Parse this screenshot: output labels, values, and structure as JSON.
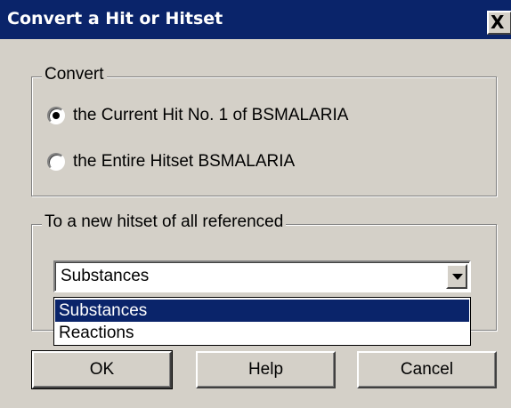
{
  "window": {
    "title": "Convert a Hit or Hitset",
    "close_icon": "close-icon",
    "close_glyph": "X"
  },
  "convert_group": {
    "label": "Convert",
    "options": [
      {
        "label": "the Current Hit No. 1 of BSMALARIA",
        "selected": true
      },
      {
        "label": "the Entire Hitset BSMALARIA",
        "selected": false
      }
    ]
  },
  "target_group": {
    "label": "To a new hitset of all referenced",
    "combo_value": "Substances",
    "dropdown_icon": "chevron-down-icon",
    "options": [
      {
        "label": "Substances",
        "highlighted": true
      },
      {
        "label": "Reactions",
        "highlighted": false
      }
    ]
  },
  "buttons": {
    "ok_label": "OK",
    "help_label": "Help",
    "cancel_label": "Cancel"
  },
  "colors": {
    "titlebar": "#0a246a",
    "face": "#d4d0c8",
    "highlight": "#0a246a"
  }
}
